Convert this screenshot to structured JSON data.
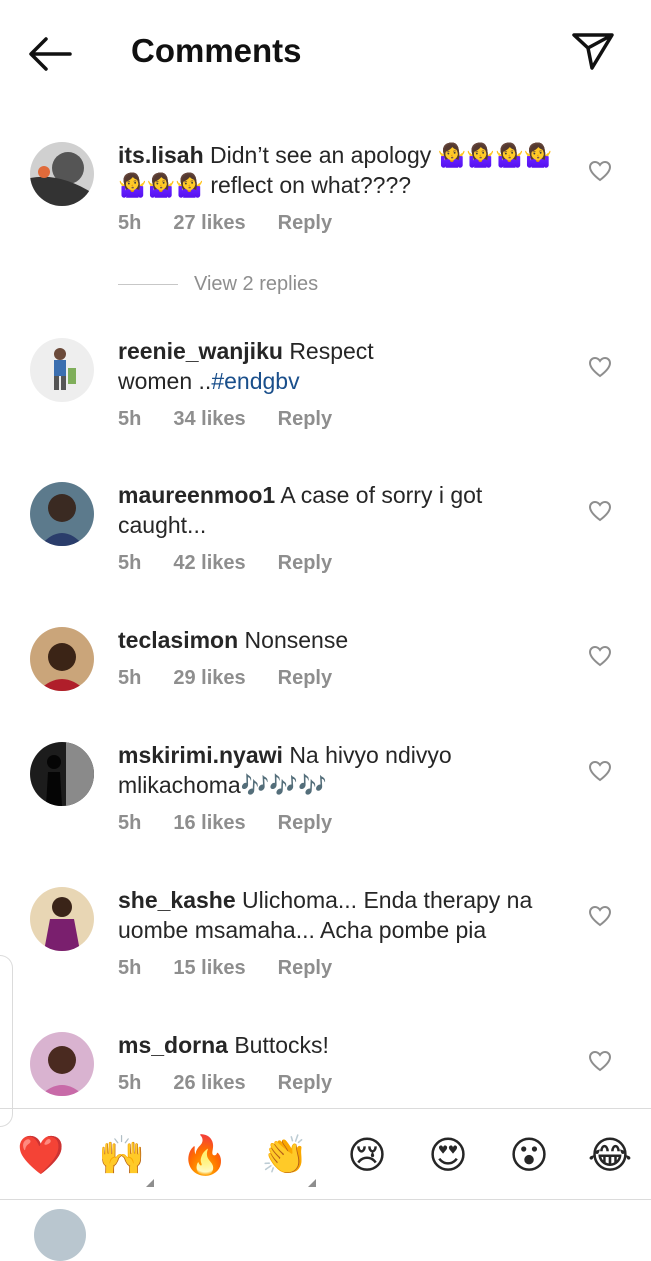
{
  "header": {
    "title": "Comments",
    "back_icon": "arrow-left-icon",
    "send_icon": "paper-plane-icon"
  },
  "comments": [
    {
      "username": "its.lisah",
      "text": "Didn’t see an apology",
      "text2": "reflect on what????",
      "time": "5h",
      "likes": "27 likes",
      "reply": "Reply"
    },
    {
      "username": "reenie_wanjiku",
      "text": "Respect women ..",
      "hashtag": "#endgbv",
      "time": "5h",
      "likes": "34 likes",
      "reply": "Reply"
    },
    {
      "username": "maureenmoo1",
      "text": "A case of sorry i got caught...",
      "time": "5h",
      "likes": "42 likes",
      "reply": "Reply"
    },
    {
      "username": "teclasimon",
      "text": "Nonsense",
      "time": "5h",
      "likes": "29 likes",
      "reply": "Reply"
    },
    {
      "username": "mskirimi.nyawi",
      "text": "Na hivyo ndivyo mlikachoma",
      "text2": "🎶🎶🎶",
      "time": "5h",
      "likes": "16 likes",
      "reply": "Reply"
    },
    {
      "username": "she_kashe",
      "text": "Ulichoma... Enda therapy na uombe msamaha... Acha pombe pia",
      "time": "5h",
      "likes": "15 likes",
      "reply": "Reply"
    },
    {
      "username": "ms_dorna",
      "text": "Buttocks!",
      "time": "5h",
      "likes": "26 likes",
      "reply": "Reply"
    }
  ],
  "view_replies": "View 2 replies",
  "shrug_emoji": "🤷‍♀️",
  "emoji_bar": [
    "❤️",
    "🙌",
    "🔥",
    "👏",
    "😢",
    "😍",
    "😮",
    "😂"
  ],
  "colors": {
    "hashtag": "#1a4f8b",
    "meta": "#8e8e8e",
    "heart": "#e0262f"
  }
}
